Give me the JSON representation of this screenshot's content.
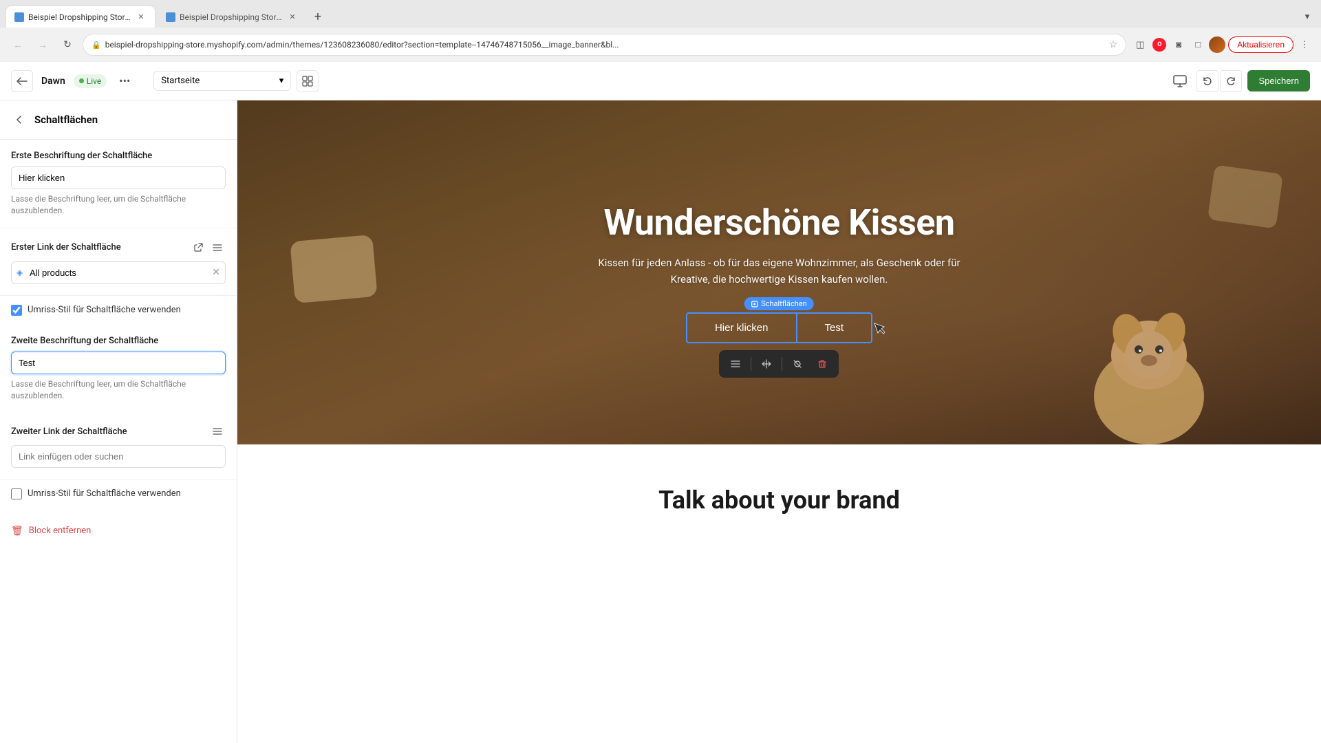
{
  "browser": {
    "tabs": [
      {
        "id": "tab1",
        "title": "Beispiel Dropshipping Store ·",
        "active": true,
        "favicon": "shop"
      },
      {
        "id": "tab2",
        "title": "Beispiel Dropshipping Store ·",
        "active": false,
        "favicon": "shop"
      }
    ],
    "new_tab_label": "+",
    "url": "beispiel-dropshipping-store.myshopify.com/admin/themes/123608236080/editor?section=template--14746748715056__image_banner&bl...",
    "update_button": "Aktualisieren"
  },
  "topbar": {
    "theme_name": "Dawn",
    "live_badge": "Live",
    "more_icon": "•••",
    "page_selector": "Startseite",
    "save_label": "Speichern"
  },
  "sidebar": {
    "back_label": "‹",
    "title": "Schaltflächen",
    "first_button_label": "Erste Beschriftung der Schaltfläche",
    "first_button_value": "Hier klicken",
    "first_button_hint": "Lasse die Beschriftung leer, um die Schaltfläche auszublenden.",
    "first_link_label": "Erster Link der Schaltfläche",
    "first_link_value": "All products",
    "outline_style_label": "Umriss-Stil für Schaltfläche verwenden",
    "outline_checked": true,
    "second_button_label": "Zweite Beschriftung der Schaltfläche",
    "second_button_value": "Test",
    "second_button_hint": "Lasse die Beschriftung leer, um die Schaltfläche auszublenden.",
    "second_link_label": "Zweiter Link der Schaltfläche",
    "second_link_placeholder": "Link einfügen oder suchen",
    "outline_style2_label": "Umriss-Stil für Schaltfläche verwenden",
    "outline2_checked": false,
    "block_remove_label": "Block entfernen"
  },
  "preview": {
    "hero_title": "Wunderschöne Kissen",
    "hero_subtitle": "Kissen für jeden Anlass - ob für das eigene Wohnzimmer, als Geschenk oder für Kreative, die hochwertige Kissen kaufen wollen.",
    "btn1_label": "Hier klicken",
    "btn2_label": "Test",
    "schaltflaechen_badge": "Schaltflächen",
    "brand_title": "Talk about your brand"
  },
  "toolbar": {
    "icon1": "≡",
    "icon2": "⇔",
    "icon3": "⊘",
    "icon4": "🗑"
  },
  "icons": {
    "back": "←",
    "chevron_down": "▾",
    "external_link": "↗",
    "stack": "⊞",
    "tag": "◈",
    "close": "✕",
    "monitor": "🖥",
    "undo": "↩",
    "redo": "↪",
    "grid": "⊞",
    "trash": "🗑",
    "pencil": "✎",
    "eye_off": "⊘"
  }
}
